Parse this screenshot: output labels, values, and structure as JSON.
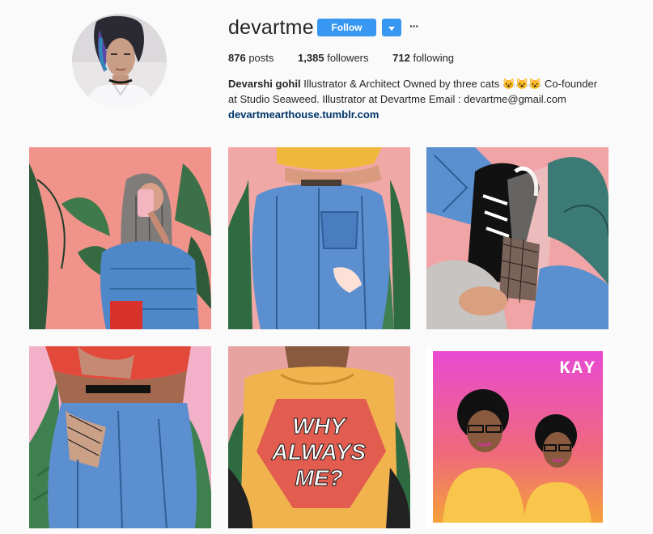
{
  "profile": {
    "username": "devartme",
    "follow_label": "Follow",
    "more_label": "···",
    "stats": {
      "posts_count": "876",
      "posts_label": "posts",
      "followers_count": "1,385",
      "followers_label": "followers",
      "following_count": "712",
      "following_label": "following"
    },
    "bio": {
      "full_name": "Devarshi gohil",
      "text": "Illustrator & Architect Owned by three cats 😺😺😺 Co-founder at Studio Seaweed. Illustrator at Devartme Email : devartme@gmail.com",
      "link": "devartmearthouse.tumblr.com"
    }
  },
  "posts": [
    {
      "name": "post-1"
    },
    {
      "name": "post-2"
    },
    {
      "name": "post-3"
    },
    {
      "name": "post-4"
    },
    {
      "name": "post-5",
      "shirt_text_1": "WHY",
      "shirt_text_2": "ALWAYS",
      "shirt_text_3": "ME?"
    },
    {
      "name": "post-6",
      "corner_text": "KAY"
    }
  ],
  "colors": {
    "accent": "#3897f0",
    "link": "#003569",
    "background": "#fafafa"
  },
  "icons": {
    "dropdown": "chevron-down-icon",
    "more": "more-options-icon"
  }
}
